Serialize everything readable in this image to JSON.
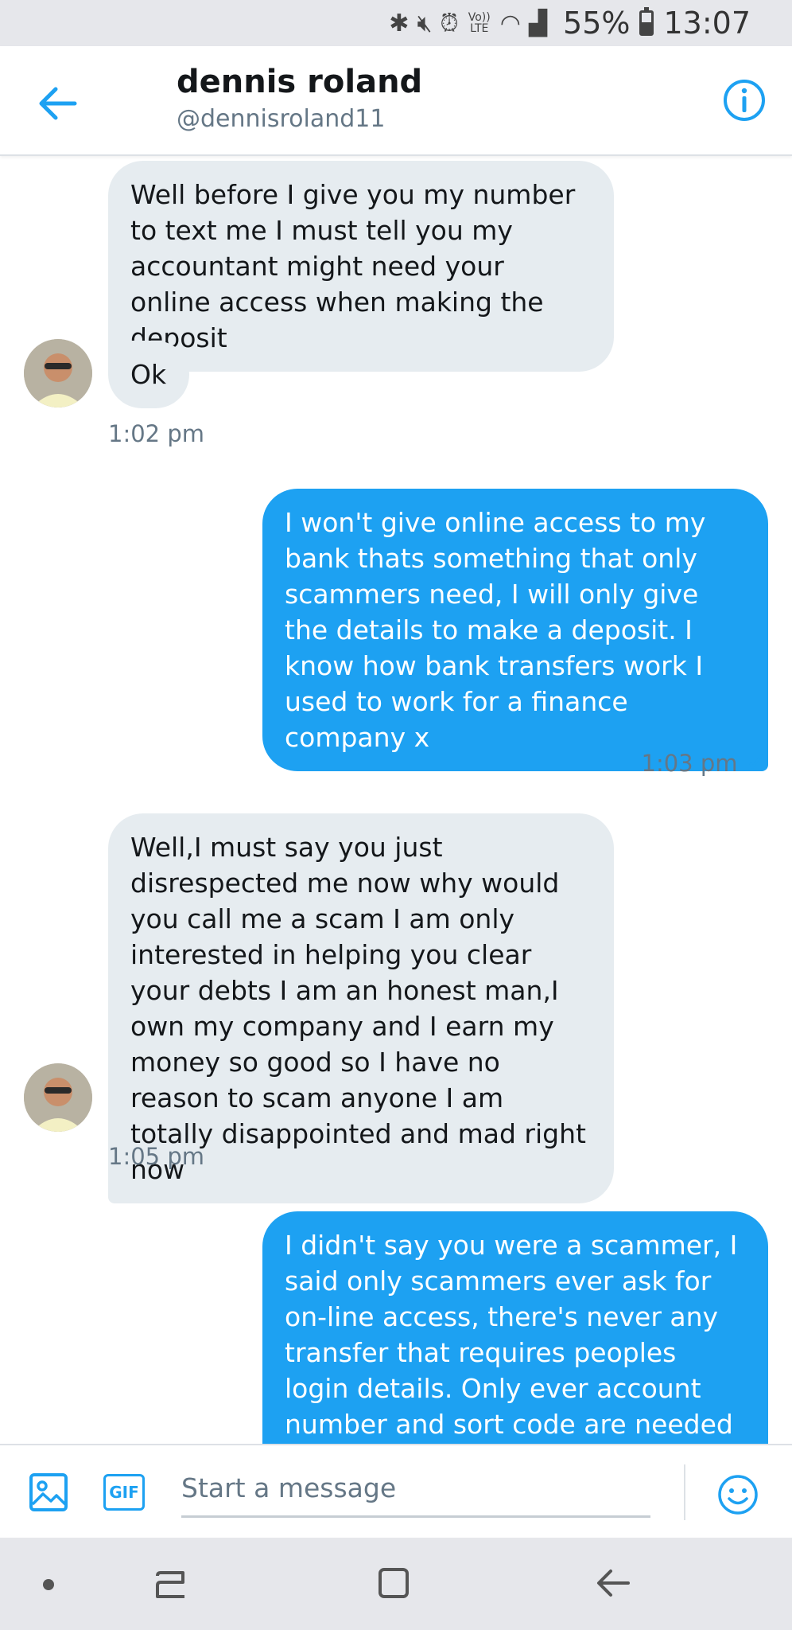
{
  "status_bar": {
    "battery_percent": "55%",
    "battery_level": 0.55,
    "time": "13:07",
    "icons": [
      "bluetooth-icon",
      "mute-icon",
      "alarm-icon",
      "volte-icon",
      "wifi-icon",
      "signal-icon",
      "battery-icon"
    ],
    "volte_label": "Vo)) LTE"
  },
  "header": {
    "name": "dennis roland",
    "handle": "@dennisroland11"
  },
  "messages": [
    {
      "direction": "in",
      "text": "Well before I give you my number to text me I must tell you my accountant might need your online access when making the deposit"
    },
    {
      "direction": "in",
      "text": "Ok"
    },
    {
      "direction": "in",
      "timestamp": "1:02 pm"
    },
    {
      "direction": "out",
      "text": "I won't give online access to my bank thats something that only scammers need, I will only give the details to make a deposit. I know how bank transfers work I used to work for a finance company x",
      "timestamp": "1:03 pm"
    },
    {
      "direction": "in",
      "text": "Well,I must say you just disrespected me now why would you call me a scam I am only interested in helping you clear your debts I am an honest man,I own my company and I earn my money so good so I have no reason to scam anyone I am totally disappointed and mad right now",
      "timestamp": "1:05 pm"
    },
    {
      "direction": "out",
      "text": "I didn't say you were a scammer, I said only scammers ever ask for on-line access, there's never any transfer that requires peoples login details. Only ever account number and sort code are needed to make deposits."
    }
  ],
  "composer": {
    "placeholder": "Start a message",
    "gif_label": "GIF"
  },
  "colors": {
    "accent": "#1da1f2",
    "incoming_bubble": "#e6ecf0",
    "secondary_text": "#657786"
  }
}
